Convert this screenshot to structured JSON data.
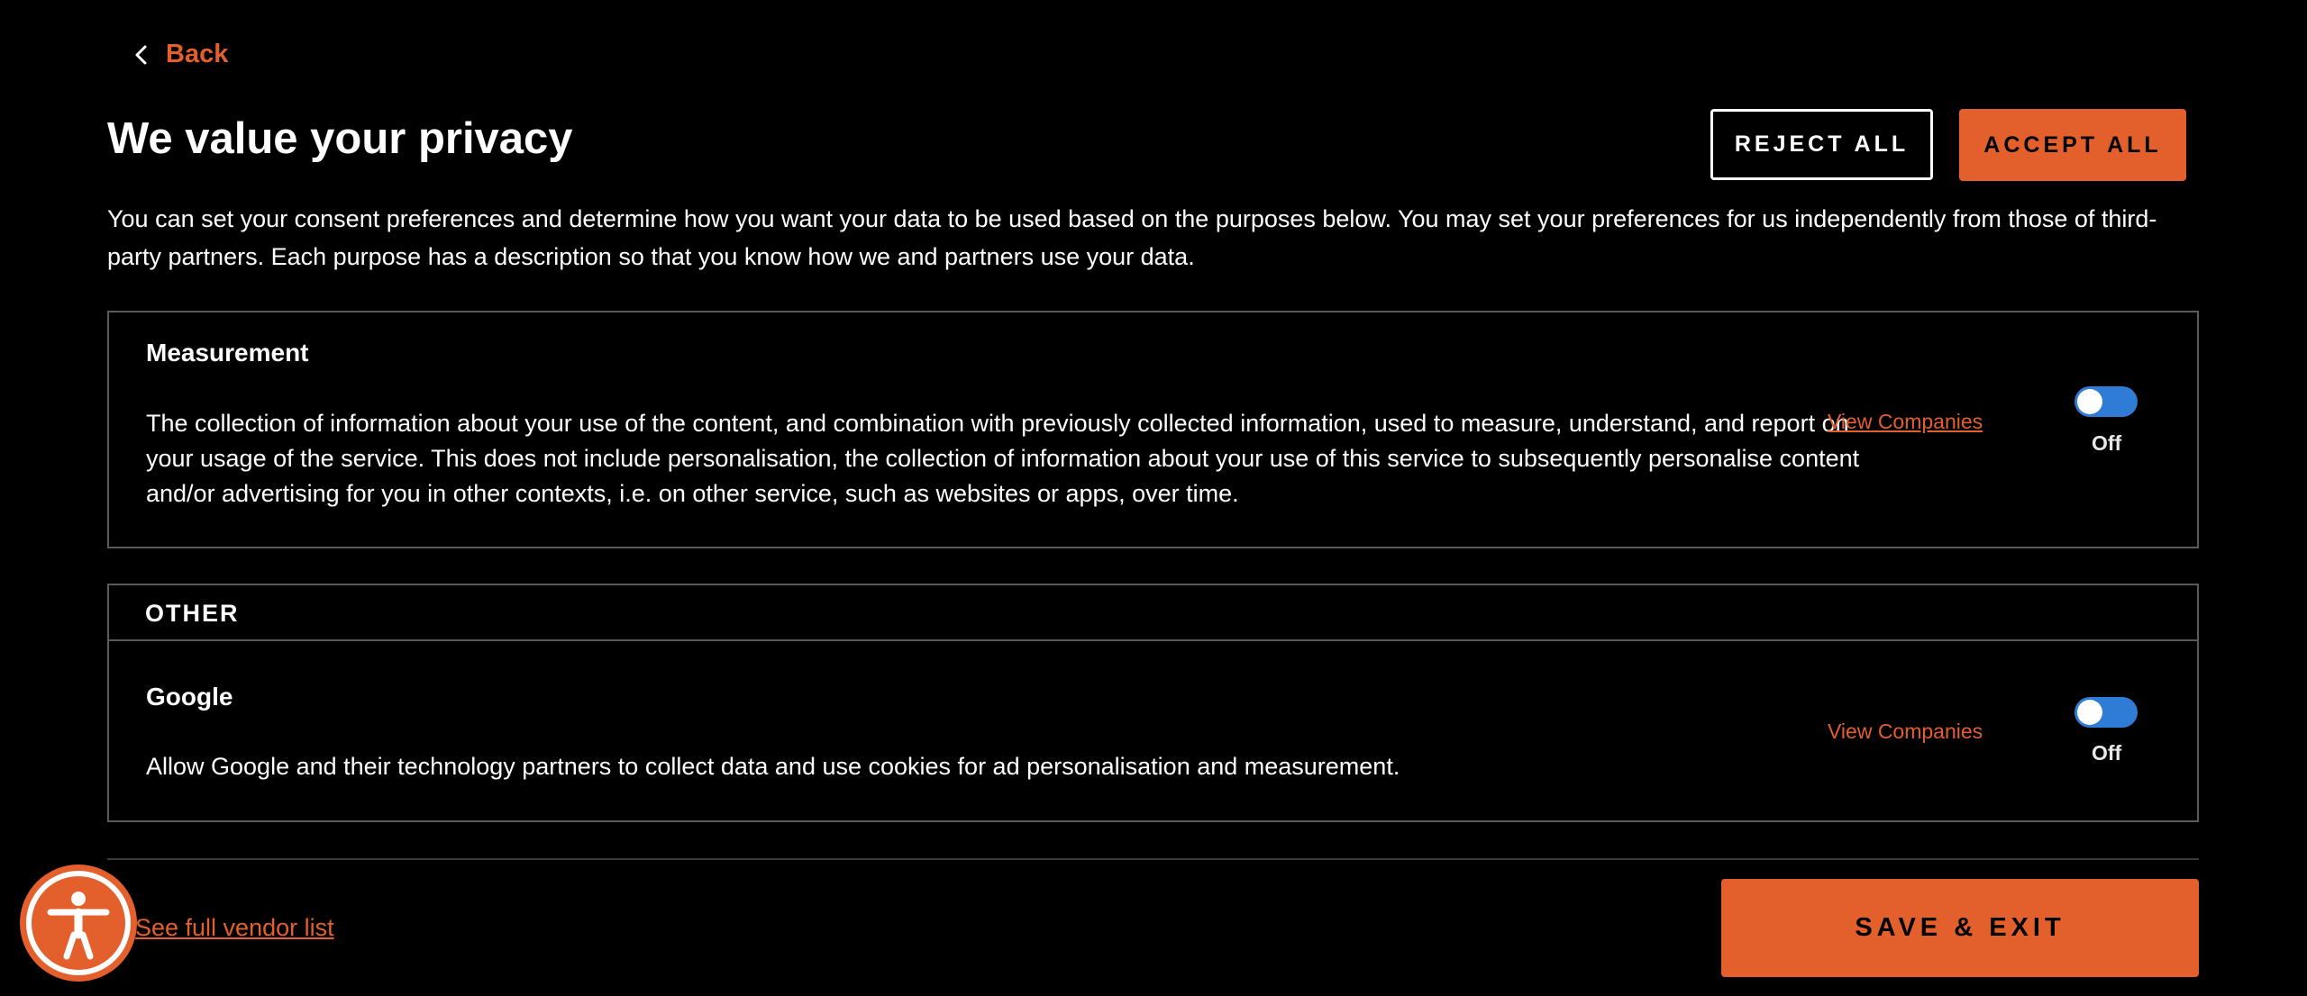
{
  "nav": {
    "back_label": "Back",
    "back_icon": "chevron-left-icon"
  },
  "header": {
    "title": "We value your privacy",
    "reject_all_label": "REJECT ALL",
    "accept_all_label": "ACCEPT ALL"
  },
  "intro_text": "You can set your consent preferences and determine how you want your data to be used based on the purposes below. You may set your preferences for us independently from those of third-party partners. Each purpose has a description so that you know how we and partners use your data.",
  "purposes": [
    {
      "title": "Measurement",
      "description": "The collection of information about your use of the content, and combination with previously collected information, used to measure, understand, and report on your usage of the service. This does not include personalisation, the collection of information about your use of this service to subsequently personalise content and/or advertising for you in other contexts, i.e. on other service, such as websites or apps, over time.",
      "link_label": "View Companies",
      "toggle_label": "Off"
    }
  ],
  "other": {
    "header": "OTHER",
    "items": [
      {
        "title": "Google",
        "description": "Allow Google and their technology partners to collect data and use cookies for ad personalisation and measurement.",
        "link_label": "View Companies",
        "toggle_label": "Off"
      }
    ]
  },
  "footer": {
    "vendor_link_label": "See full vendor list",
    "save_label": "SAVE & EXIT",
    "accessibility_icon": "accessibility-icon"
  },
  "colors": {
    "accent": "#e35f2c",
    "toggle": "#2f7cd6",
    "background": "#000000",
    "border": "#5a5a5a"
  }
}
